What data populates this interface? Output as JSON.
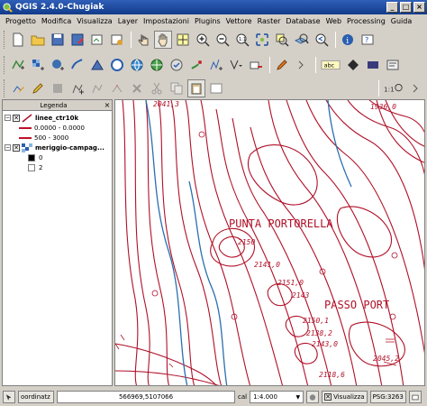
{
  "window": {
    "title": "QGIS 2.4.0-Chugiak",
    "minimize": "_",
    "maximize": "□",
    "close": "×"
  },
  "menu": [
    "Progetto",
    "Modifica",
    "Visualizza",
    "Layer",
    "Impostazioni",
    "Plugins",
    "Vettore",
    "Raster",
    "Database",
    "Web",
    "Processing",
    "Guida"
  ],
  "toolbar": {
    "abc_label": "abc"
  },
  "legend": {
    "title": "Legenda",
    "close": "×",
    "layers": [
      {
        "name": "linee_ctr10k",
        "expanded": "−",
        "checked": "✕",
        "classes": [
          {
            "label": "0.0000 - 0.0000",
            "color": "#c0102a"
          },
          {
            "label": "500 - 3000",
            "color": "#c0102a"
          }
        ]
      },
      {
        "name": "meriggio-campag...",
        "expanded": "−",
        "checked": "✕",
        "classes": [
          {
            "label": "0",
            "color": "#000000"
          },
          {
            "label": "2",
            "color": "#ffffff"
          }
        ]
      }
    ]
  },
  "map": {
    "labels": [
      "PUNTA PORTORELLA",
      "PASSO PORT"
    ],
    "elevations": [
      "2041,3",
      "1936,0",
      "2150",
      "2141,0",
      "2151,0",
      "2143",
      "2150,1",
      "2138,2",
      "2143,0",
      "2045,2",
      "2118,6"
    ],
    "contour_color": "#b01028",
    "stream_color": "#2a6fb0"
  },
  "status": {
    "coord_button": "oordinatz",
    "coordinates": "566969,5107066",
    "scale_label": "cal",
    "scale": "1:4.000",
    "render_label": "Visualizza",
    "crs": "PSG:3263"
  }
}
